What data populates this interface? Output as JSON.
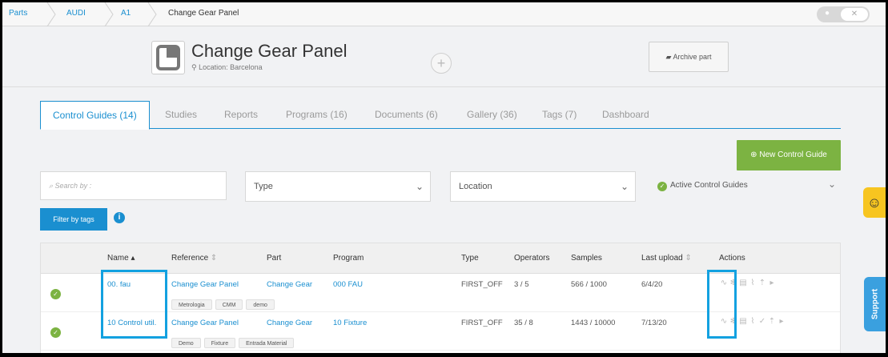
{
  "breadcrumb": {
    "items": [
      "Parts",
      "AUDI",
      "A1",
      "Change Gear Panel"
    ]
  },
  "header": {
    "title": "Change Gear Panel",
    "location": "Location: Barcelona",
    "archive_label": "Archive part",
    "add_label": "+"
  },
  "tabs": [
    {
      "label": "Control Guides (14)",
      "active": true
    },
    {
      "label": "Studies"
    },
    {
      "label": "Reports"
    },
    {
      "label": "Programs (16)"
    },
    {
      "label": "Documents (6)"
    },
    {
      "label": "Gallery (36)"
    },
    {
      "label": "Tags (7)"
    },
    {
      "label": "Dashboard"
    }
  ],
  "toolbar": {
    "new_guide_label": "New Control Guide",
    "search_placeholder": "Search by :",
    "type_label": "Type",
    "location_label": "Location",
    "active_guides_label": "Active Control Guides",
    "filter_tags_label": "Filter by tags",
    "info_label": "i"
  },
  "table": {
    "headers": [
      "Name",
      "Reference",
      "Part",
      "Program",
      "Type",
      "Operators",
      "Samples",
      "Last upload",
      "Actions"
    ],
    "rows": [
      {
        "name": "00. fau",
        "reference": "Change Gear Panel",
        "part": "Change Gear",
        "program": "000 FAU",
        "type": "FIRST_OFF",
        "operators": "3 / 5",
        "samples": "566 / 1000",
        "last_upload": "6/4/20",
        "tags": [
          "Metrologia",
          "CMM",
          "demo"
        ]
      },
      {
        "name": "10 Control util.",
        "reference": "Change Gear Panel",
        "part": "Change Gear",
        "program": "10 Fixture",
        "type": "FIRST_OFF",
        "operators": "35 / 8",
        "samples": "1443 / 10000",
        "last_upload": "7/13/20",
        "tags": [
          "Demo",
          "Fixture",
          "Entrada Material"
        ]
      }
    ]
  },
  "widgets": {
    "smiley": "☺",
    "support_label": "Support"
  },
  "colors": {
    "accent": "#1a8fd0",
    "green": "#7cb342",
    "highlight": "#13a1e0"
  }
}
